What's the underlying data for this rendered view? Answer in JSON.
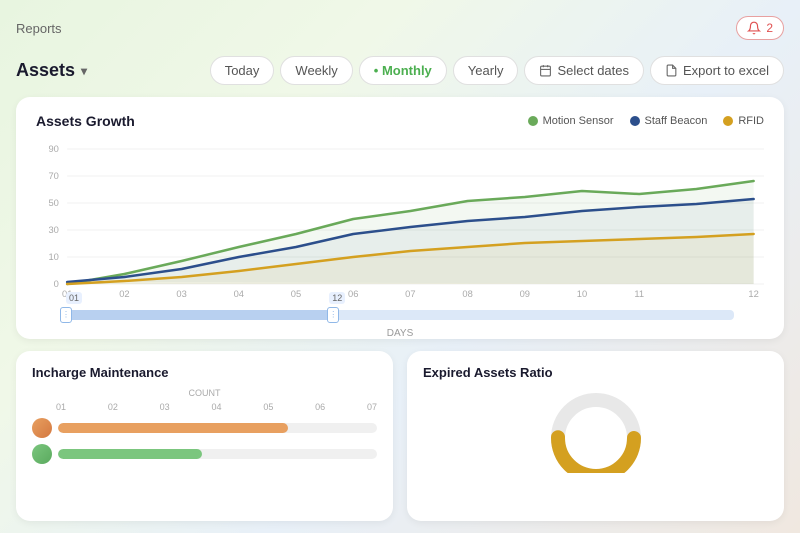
{
  "header": {
    "title": "Reports",
    "notification_count": "2"
  },
  "assets": {
    "title": "Assets",
    "filters": [
      {
        "label": "Today",
        "active": false
      },
      {
        "label": "Weekly",
        "active": false
      },
      {
        "label": "Monthly",
        "active": true
      },
      {
        "label": "Yearly",
        "active": false
      }
    ],
    "select_dates_label": "Select dates",
    "export_label": "Export to excel"
  },
  "chart": {
    "title": "Assets Growth",
    "legend": [
      {
        "label": "Motion Sensor",
        "color": "#6aaa5a"
      },
      {
        "label": "Staff Beacon",
        "color": "#2c4f8c"
      },
      {
        "label": "RFID",
        "color": "#d4a020"
      }
    ],
    "y_axis": [
      "90",
      "70",
      "50",
      "30",
      "10",
      "0"
    ],
    "x_axis": [
      "01",
      "02",
      "03",
      "04",
      "05",
      "06",
      "07",
      "08",
      "09",
      "10",
      "11",
      "12"
    ],
    "x_label": "DAYS",
    "slider": {
      "left_label": "01",
      "right_label": "12"
    }
  },
  "maintenance": {
    "title": "Incharge Maintenance",
    "count_label": "COUNT",
    "x_axis": [
      "01",
      "02",
      "03",
      "04",
      "05",
      "06",
      "07"
    ],
    "bars": [
      {
        "width": "72%",
        "color": "orange"
      },
      {
        "width": "45%",
        "color": "green"
      }
    ]
  },
  "expired": {
    "title": "Expired Assets Ratio"
  }
}
